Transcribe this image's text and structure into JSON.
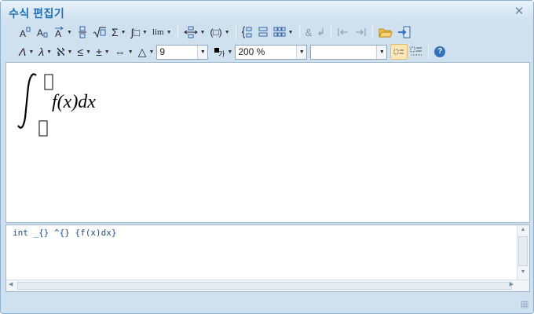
{
  "window": {
    "title": "수식 편집기",
    "close_icon": "close-x-icon"
  },
  "toolbar1": [
    {
      "name": "superscript-icon",
      "caret": false
    },
    {
      "name": "subscript-icon",
      "caret": false
    },
    {
      "name": "accent-icon",
      "caret": true
    },
    {
      "name": "fraction-icon",
      "caret": false
    },
    {
      "name": "root-icon",
      "caret": false
    },
    {
      "name": "sum-icon",
      "glyph": "Σ",
      "caret": true
    },
    {
      "name": "integral-icon",
      "glyph": "∫□",
      "caret": true
    },
    {
      "name": "limit-icon",
      "glyph": "lim",
      "caret": true
    },
    {
      "name": "arrow-stack-icon",
      "caret": true
    },
    {
      "name": "parenthesis-icon",
      "glyph": "(□)",
      "caret": true
    },
    {
      "name": "case-icon",
      "caret": false
    },
    {
      "name": "column-icon",
      "caret": false
    },
    {
      "name": "matrix-icon",
      "caret": true
    },
    {
      "name": "ampersand-icon",
      "glyph": "&",
      "caret": false
    },
    {
      "name": "line-break-icon",
      "glyph": "↲",
      "caret": false
    },
    {
      "name": "move-left-icon",
      "caret": false
    },
    {
      "name": "move-right-icon",
      "caret": false
    },
    {
      "name": "open-folder-icon",
      "caret": false
    },
    {
      "name": "insert-icon",
      "caret": false
    }
  ],
  "toolbar2": {
    "symbols": [
      {
        "name": "greek-upper-icon",
        "glyph": "Λ"
      },
      {
        "name": "greek-lower-icon",
        "glyph": "λ"
      },
      {
        "name": "hebrew-icon",
        "glyph": "ℵ"
      },
      {
        "name": "relation-icon",
        "glyph": "≤"
      },
      {
        "name": "operator-icon",
        "glyph": "±"
      },
      {
        "name": "arrow-icon",
        "glyph": "⇔"
      },
      {
        "name": "misc-symbol-icon",
        "glyph": "△"
      }
    ],
    "font_size": "9",
    "color_icon": "text-color-icon",
    "zoom": "200 %",
    "font_select": "",
    "help_label": "?"
  },
  "formula": {
    "integrand": "f(x)dx"
  },
  "source": {
    "text": "int _{} ^{} {f(x)dx}"
  }
}
